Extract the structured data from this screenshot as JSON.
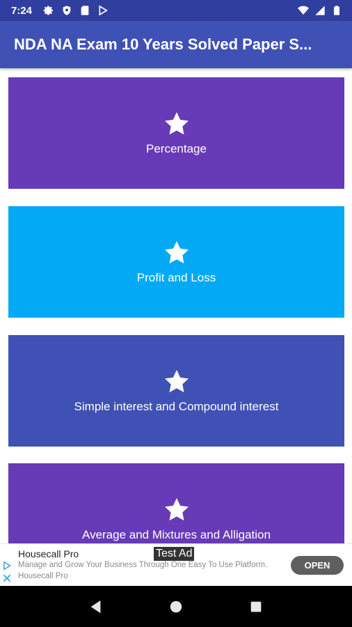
{
  "status_bar": {
    "time": "7:24",
    "left_icons": [
      "settings-icon",
      "shield-icon",
      "sd-card-icon",
      "play-store-icon"
    ],
    "right_icons": [
      "wifi-icon",
      "signal-icon",
      "battery-icon"
    ]
  },
  "app_bar": {
    "title": "NDA NA Exam 10 Years Solved Paper S..."
  },
  "cards": [
    {
      "label": "Percentage",
      "color": "#673ab7",
      "icon": "star-icon"
    },
    {
      "label": "Profit and Loss",
      "color": "#03a9f4",
      "icon": "star-icon"
    },
    {
      "label": "Simple interest and Compound interest",
      "color": "#3f51b5",
      "icon": "star-icon"
    },
    {
      "label": "Average and Mixtures and Alligation",
      "color": "#673ab7",
      "icon": "star-icon"
    }
  ],
  "ad": {
    "tag": "Test Ad",
    "advertiser": "Housecall Pro",
    "description": "Manage and Grow Your Business Through One Easy To Use Platform.",
    "sub": "Housecall Pro",
    "cta": "OPEN"
  },
  "nav_bar": {
    "buttons": [
      "back-icon",
      "home-icon",
      "recents-icon"
    ]
  },
  "colors": {
    "status_bar": "#303f9f",
    "app_bar": "#3f51b5"
  }
}
